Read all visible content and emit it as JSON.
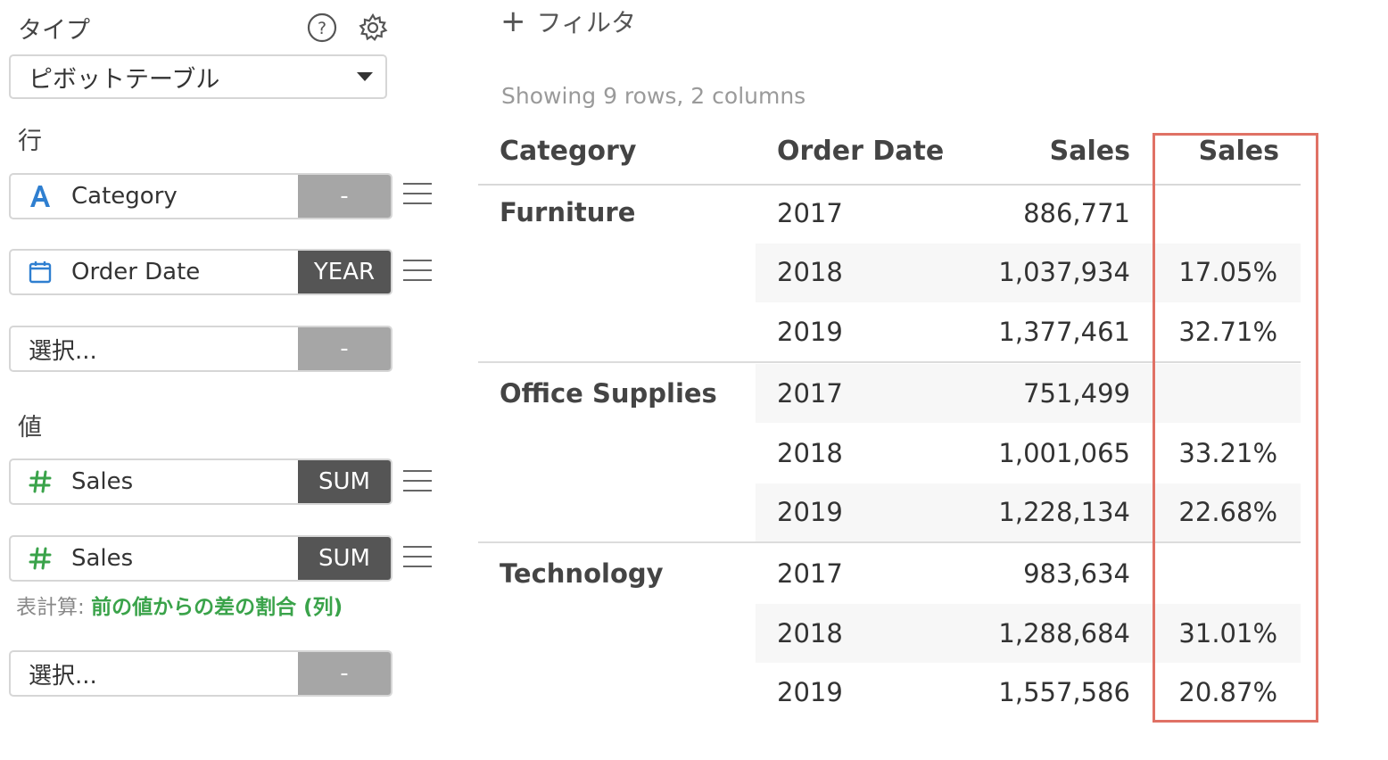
{
  "sidebar": {
    "type_label": "タイプ",
    "chart_type": "ピボットテーブル",
    "rows_label": "行",
    "rows": [
      {
        "icon": "text-type-icon",
        "name": "Category",
        "agg": "-",
        "agg_style": "light"
      },
      {
        "icon": "calendar-icon",
        "name": "Order Date",
        "agg": "YEAR",
        "agg_style": "dark"
      }
    ],
    "rows_placeholder": "選択...",
    "rows_placeholder_agg": "-",
    "values_label": "値",
    "values": [
      {
        "icon": "number-type-icon",
        "name": "Sales",
        "agg": "SUM",
        "agg_style": "dark"
      },
      {
        "icon": "number-type-icon",
        "name": "Sales",
        "agg": "SUM",
        "agg_style": "dark"
      }
    ],
    "calc_prefix": "表計算:",
    "calc_value": "前の値からの差の割合 (列)",
    "values_placeholder": "選択...",
    "values_placeholder_agg": "-"
  },
  "main": {
    "add_filter": "フィルタ",
    "row_count": "Showing 9 rows, 2 columns",
    "columns": [
      "Category",
      "Order Date",
      "Sales",
      "Sales"
    ],
    "rows": [
      {
        "category": "Furniture",
        "year": "2017",
        "sales": "886,771",
        "diff": ""
      },
      {
        "category": "",
        "year": "2018",
        "sales": "1,037,934",
        "diff": "17.05%"
      },
      {
        "category": "",
        "year": "2019",
        "sales": "1,377,461",
        "diff": "32.71%"
      },
      {
        "category": "Office Supplies",
        "year": "2017",
        "sales": "751,499",
        "diff": ""
      },
      {
        "category": "",
        "year": "2018",
        "sales": "1,001,065",
        "diff": "33.21%"
      },
      {
        "category": "",
        "year": "2019",
        "sales": "1,228,134",
        "diff": "22.68%"
      },
      {
        "category": "Technology",
        "year": "2017",
        "sales": "983,634",
        "diff": ""
      },
      {
        "category": "",
        "year": "2018",
        "sales": "1,288,684",
        "diff": "31.01%"
      },
      {
        "category": "",
        "year": "2019",
        "sales": "1,557,586",
        "diff": "20.87%"
      }
    ]
  },
  "colors": {
    "accent_green": "#3aa34a",
    "text_icon_blue": "#2f7fd0",
    "highlight_red": "#e07165",
    "agg_dark": "#555555",
    "agg_light": "#a6a6a6"
  }
}
